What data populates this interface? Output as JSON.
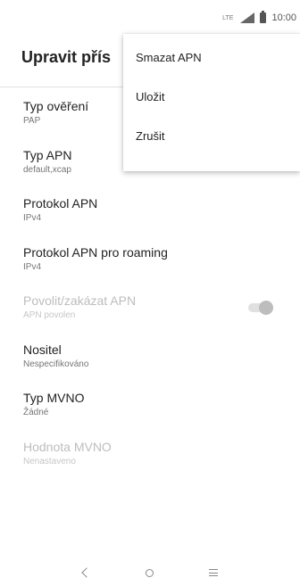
{
  "status_bar": {
    "network_label": "LTE",
    "time": "10:00"
  },
  "app_bar": {
    "title": "Upravit přís"
  },
  "menu": {
    "items": [
      {
        "label": "Smazat APN"
      },
      {
        "label": "Uložit"
      },
      {
        "label": "Zrušit"
      }
    ]
  },
  "preferences": [
    {
      "title": "Typ ověření",
      "summary": "PAP"
    },
    {
      "title": "Typ APN",
      "summary": "default,xcap"
    },
    {
      "title": "Protokol APN",
      "summary": "IPv4"
    },
    {
      "title": "Protokol APN pro roaming",
      "summary": "IPv4"
    },
    {
      "title": "Povolit/zakázat APN",
      "summary": "APN povolen",
      "disabled": true,
      "switch_on": true
    },
    {
      "title": "Nositel",
      "summary": "Nespecifikováno"
    },
    {
      "title": "Typ MVNO",
      "summary": "Žádné"
    },
    {
      "title": "Hodnota MVNO",
      "summary": "Nenastaveno",
      "disabled": true
    }
  ],
  "nav": {
    "back_icon": "back-icon",
    "home_icon": "home-icon",
    "recents_icon": "recents-icon"
  }
}
